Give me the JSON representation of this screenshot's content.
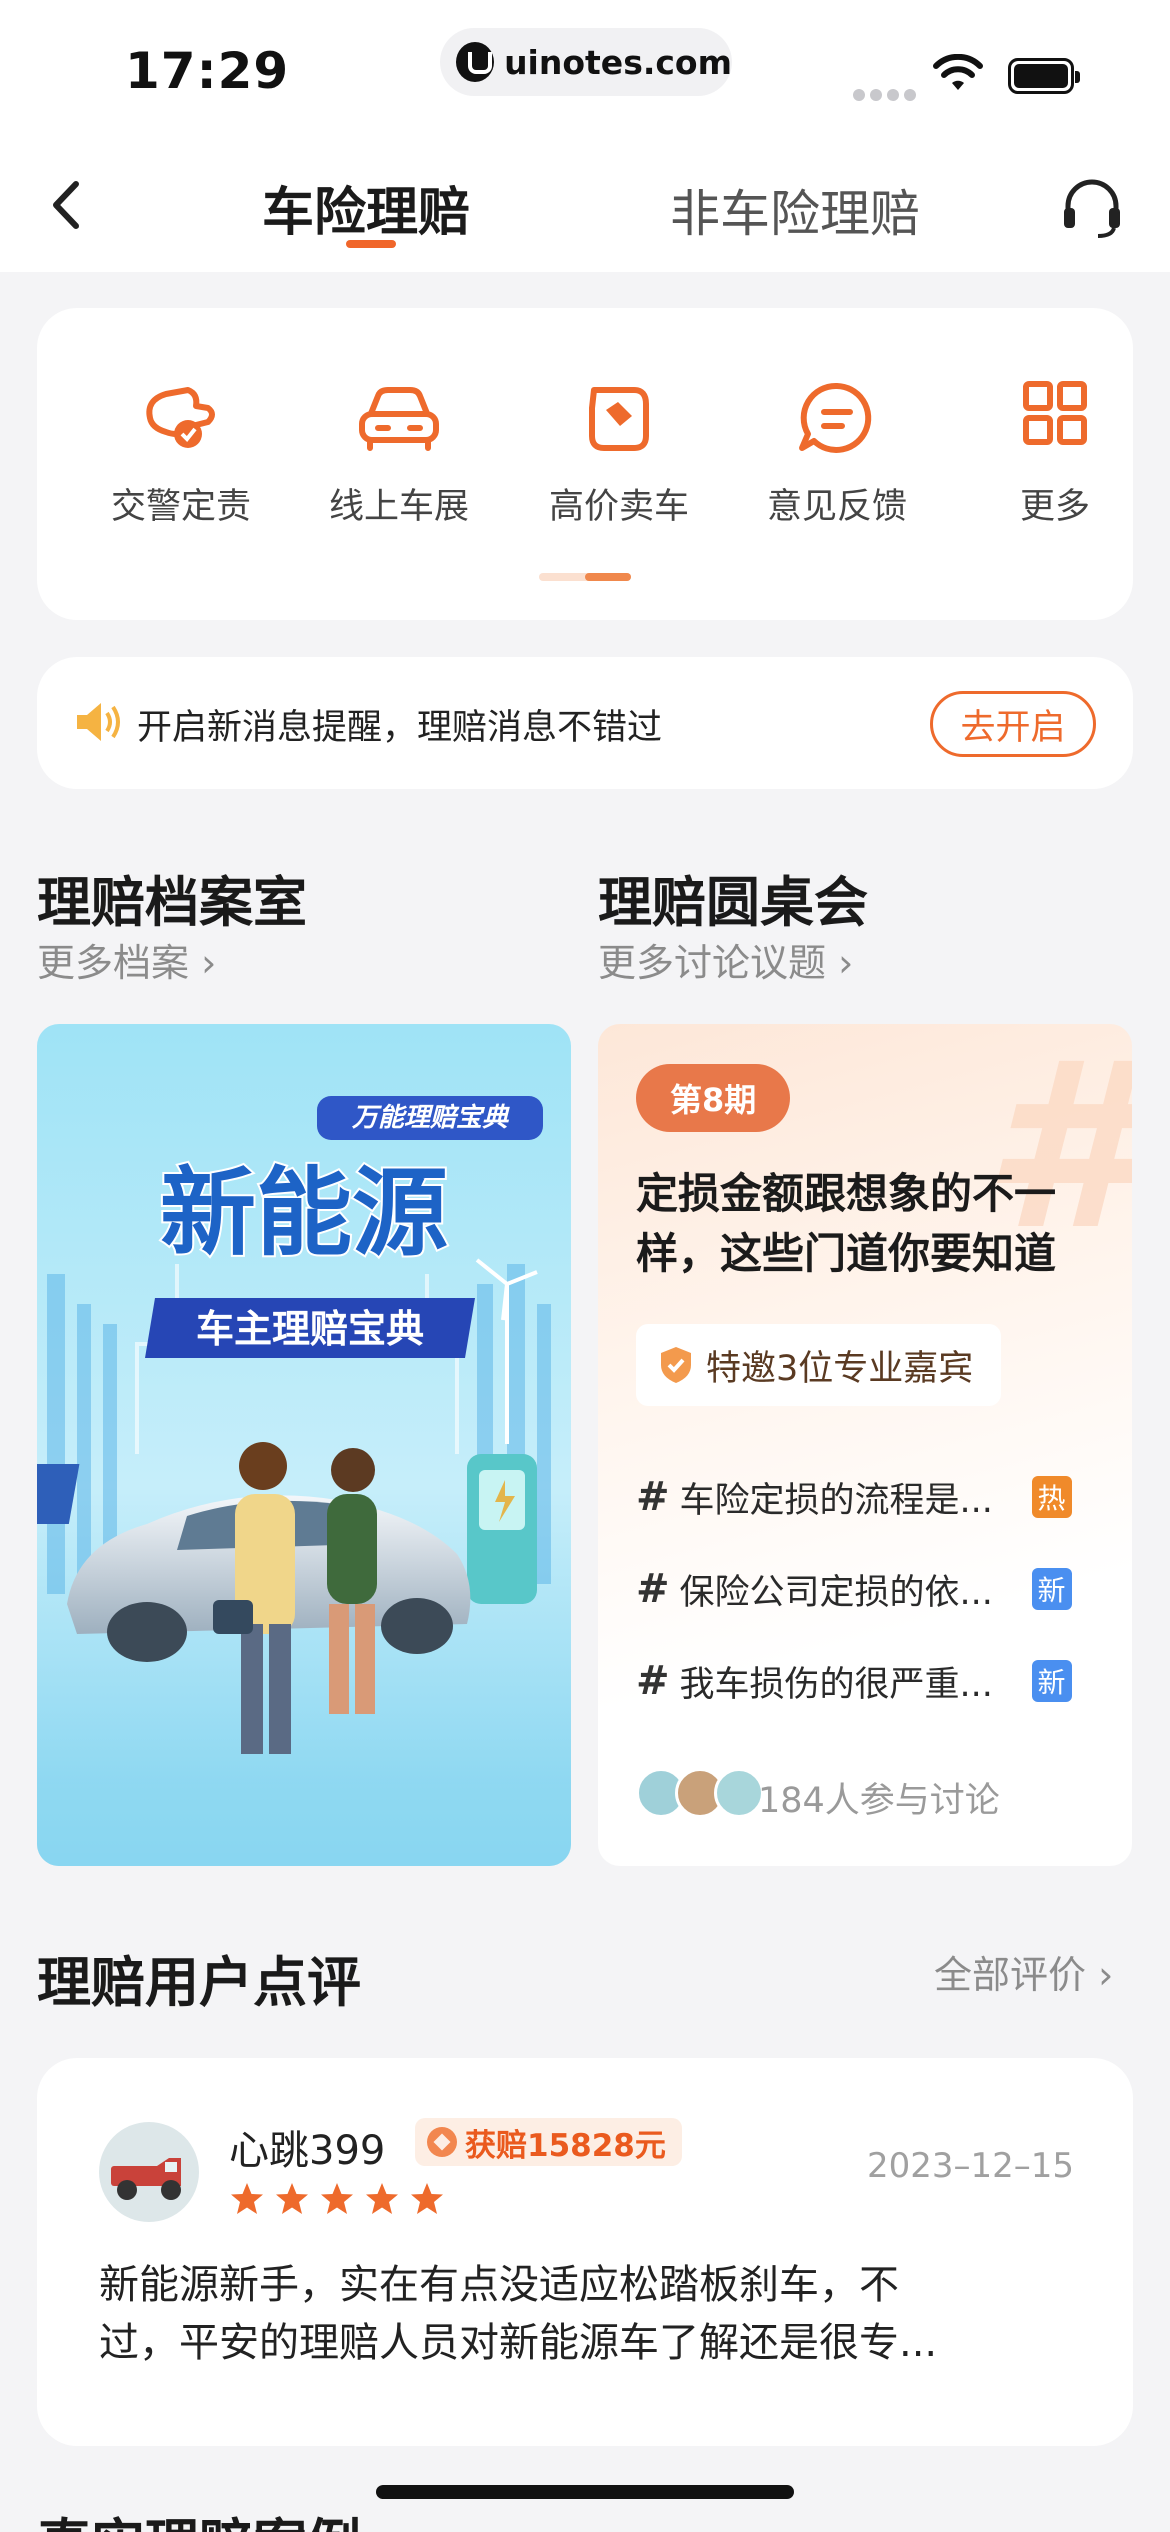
{
  "status_bar": {
    "time": "17:29",
    "url": "uinotes.com"
  },
  "nav": {
    "tabs": [
      {
        "label": "车险理赔",
        "active": true
      },
      {
        "label": "非车险理赔",
        "active": false
      }
    ]
  },
  "quick_actions": [
    {
      "label": "交警定责",
      "icon": "police-icon"
    },
    {
      "label": "线上车展",
      "icon": "car-icon"
    },
    {
      "label": "高价卖车",
      "icon": "price-tag-icon"
    },
    {
      "label": "意见反馈",
      "icon": "feedback-icon"
    },
    {
      "label": "更多",
      "icon": "grid-icon"
    }
  ],
  "quick_page_indicator": {
    "pages": 2,
    "current": 2
  },
  "notice": {
    "text": "开启新消息提醒，理赔消息不错过",
    "button": "去开启"
  },
  "sections": {
    "archive": {
      "title": "理赔档案室",
      "more": "更多档案"
    },
    "roundtable": {
      "title": "理赔圆桌会",
      "more": "更多讨论议题"
    }
  },
  "archive_banner": {
    "badge": "万能理赔宝典",
    "headline": "新能源",
    "subtitle": "车主理赔宝典"
  },
  "roundtable_card": {
    "issue": "第8期",
    "title": "定损金额跟想象的不一样，这些门道你要知道",
    "guest": "特邀3位专业嘉宾",
    "topics": [
      {
        "text": "车险定损的流程是...",
        "tag": "热",
        "tag_type": "hot"
      },
      {
        "text": "保险公司定损的依...",
        "tag": "新",
        "tag_type": "new"
      },
      {
        "text": "我车损伤的很严重...",
        "tag": "新",
        "tag_type": "new"
      }
    ],
    "participants": "184人参与讨论"
  },
  "reviews_section": {
    "title": "理赔用户点评",
    "more": "全部评价"
  },
  "review": {
    "user": "心跳399",
    "badge": "获赔15828元",
    "stars": 5,
    "date": "2023–12–15",
    "text_line1": "新能源新手，实在有点没适应松踏板刹车，不",
    "text_line2": "过，平安的理赔人员对新能源车了解还是很专..."
  },
  "next_section": {
    "title": "真实理赔案例"
  },
  "colors": {
    "accent": "#ee6a2c",
    "tag_hot": "#f08a2a",
    "tag_new": "#4a8ff0"
  }
}
